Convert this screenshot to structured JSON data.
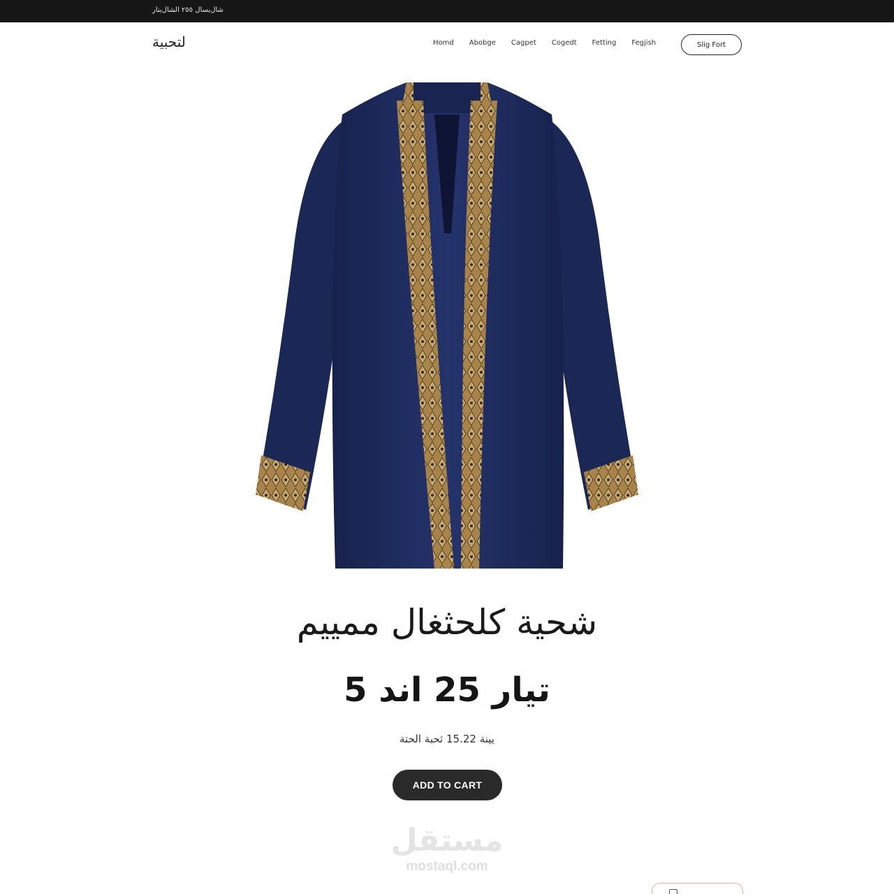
{
  "topbar": {
    "text": "شال‌بسال ٢٥٥ الشال‌بنار"
  },
  "header": {
    "logo": "لتحبية",
    "nav": [
      "Homd",
      "Abobge",
      "Cagpet",
      "Cogedt",
      "Fetting",
      "Fegjish"
    ],
    "cta_label": "Slig Fort"
  },
  "product": {
    "image_icon": "embroidered-navy-robe-image",
    "title": "شحية كلحثغال ممييم",
    "subtitle": "تيار 25 اند 5",
    "price_line": "يينة 15.22 ثحبة الحتة",
    "add_to_cart": "ADD TO CART"
  },
  "watermark": {
    "arabic": "مستقل",
    "latin": "mostaql.com"
  },
  "colors": {
    "topbar": "#161616",
    "robe": "#1d2a5c",
    "embroidery": "#b08b4f",
    "button": "#2a2a2a",
    "corner_border": "#d4b98a"
  }
}
